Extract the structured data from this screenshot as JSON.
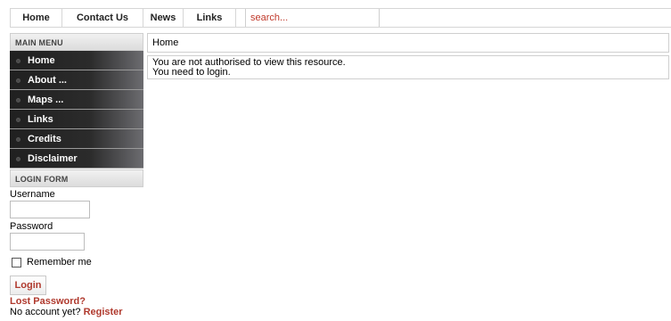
{
  "topnav": {
    "items": [
      {
        "label": "Home"
      },
      {
        "label": "Contact Us"
      },
      {
        "label": "News"
      },
      {
        "label": "Links"
      }
    ],
    "search_placeholder": "search..."
  },
  "sidebar": {
    "main_menu_title": "MAIN MENU",
    "menu_items": [
      {
        "label": "Home"
      },
      {
        "label": "About ..."
      },
      {
        "label": "Maps ..."
      },
      {
        "label": "Links"
      },
      {
        "label": "Credits"
      },
      {
        "label": "Disclaimer"
      }
    ],
    "login_form": {
      "title": "LOGIN FORM",
      "username_label": "Username",
      "username_value": "",
      "password_label": "Password",
      "password_value": "",
      "remember_label": "Remember me",
      "login_button": "Login",
      "lost_password": "Lost Password?",
      "no_account": "No account yet?",
      "register": "Register"
    }
  },
  "main": {
    "breadcrumb": "Home",
    "message_line1": "You are not authorised to view this resource.",
    "message_line2": "You need to login."
  },
  "colors": {
    "accent_red": "#b03a2e",
    "menu_dark": "#202020",
    "border": "#cfcfcf"
  }
}
